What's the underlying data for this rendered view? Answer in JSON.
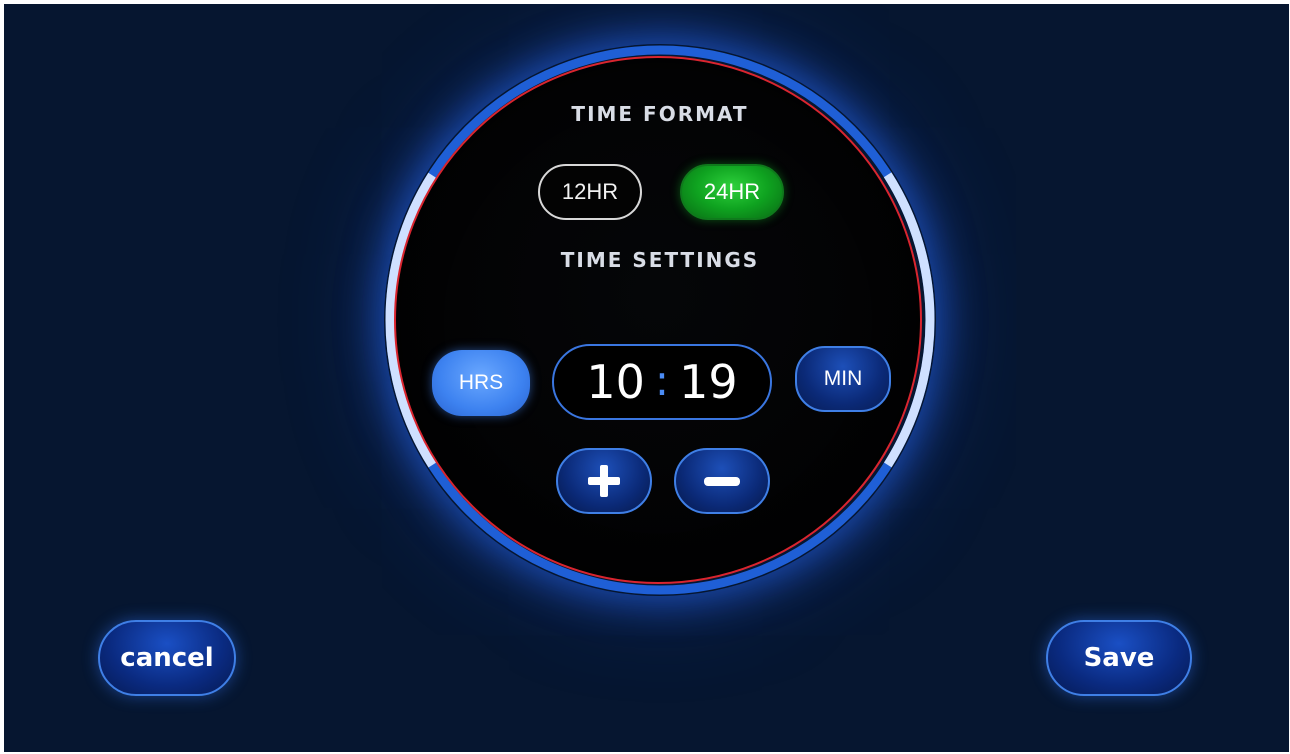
{
  "time_format": {
    "heading": "TIME FORMAT",
    "options": [
      {
        "label": "12HR",
        "selected": false
      },
      {
        "label": "24HR",
        "selected": true
      }
    ]
  },
  "time_settings": {
    "heading": "TIME SETTINGS",
    "hours_button": "HRS",
    "minutes_button": "MIN",
    "hours": "10",
    "separator": ":",
    "minutes": "19",
    "active_field": "HRS",
    "increment_icon": "plus-icon",
    "decrement_icon": "minus-icon"
  },
  "actions": {
    "cancel_label": "cancel",
    "save_label": "Save"
  },
  "colors": {
    "background": "#061630",
    "accent_blue": "#3d82f0",
    "selected_green": "#0fa320",
    "dial_border_red": "#d9252f"
  }
}
